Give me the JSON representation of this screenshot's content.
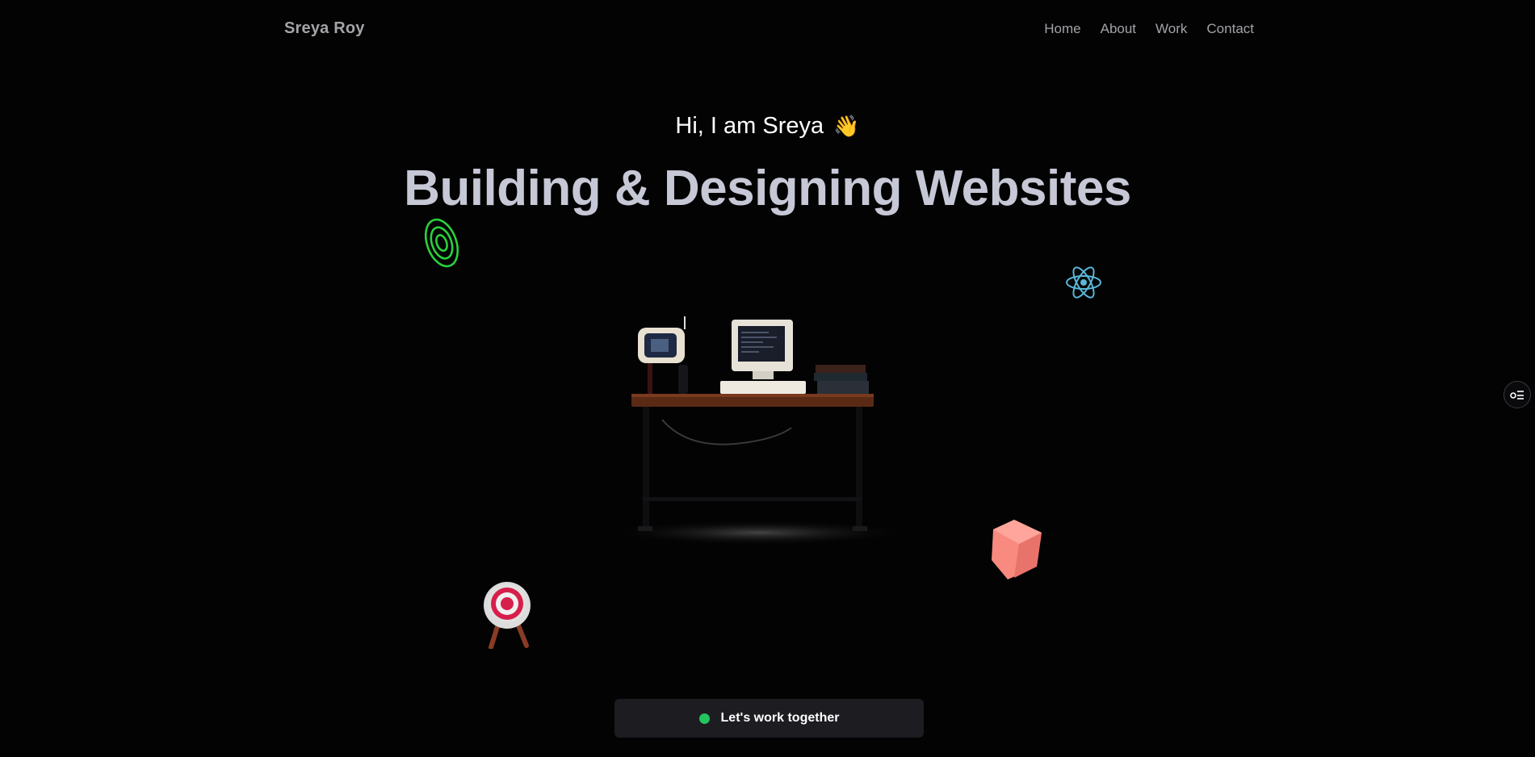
{
  "nav": {
    "brand": "Sreya Roy",
    "links": [
      "Home",
      "About",
      "Work",
      "Contact"
    ]
  },
  "hero": {
    "greeting": "Hi, I am Sreya",
    "wave_emoji": "👋",
    "headline": "Building & Designing Websites"
  },
  "cta": {
    "label": "Let's work together",
    "status_color": "#22c55e"
  },
  "icons": {
    "ring": "ring-icon",
    "react": "react-icon",
    "target": "target-icon",
    "cube": "cube-icon",
    "desk": "desk-scene",
    "side_toggle": "settings-toggle-icon"
  },
  "colors": {
    "background": "#030304",
    "headline": "#c6c8d6",
    "nav_text": "#a3a3a8",
    "cta_bg": "#1c1c21"
  }
}
